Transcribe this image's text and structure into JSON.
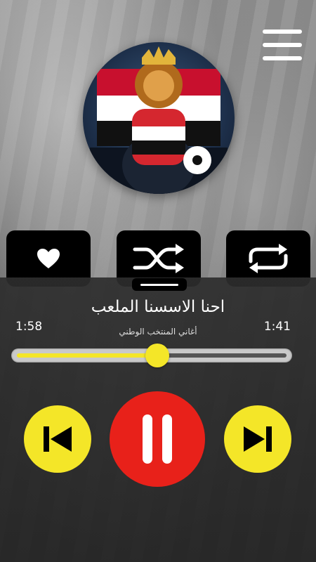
{
  "menu": {
    "icon": "hamburger-menu-icon"
  },
  "album_art": {
    "description_icon": "album-art"
  },
  "actions": {
    "favorite_icon": "heart-icon",
    "shuffle_icon": "shuffle-icon",
    "repeat_icon": "repeat-icon"
  },
  "track": {
    "title": "احنا الاسسنا الملعب",
    "subtitle": "أغاني المنتخب الوطني",
    "elapsed": "1:41",
    "duration": "1:58",
    "progress": 0.52
  },
  "controls": {
    "prev_icon": "skip-previous-icon",
    "pause_icon": "pause-icon",
    "next_icon": "skip-next-icon"
  },
  "colors": {
    "accent_yellow": "#f4e628",
    "pause_red": "#e8211a",
    "control_black": "#000000"
  }
}
